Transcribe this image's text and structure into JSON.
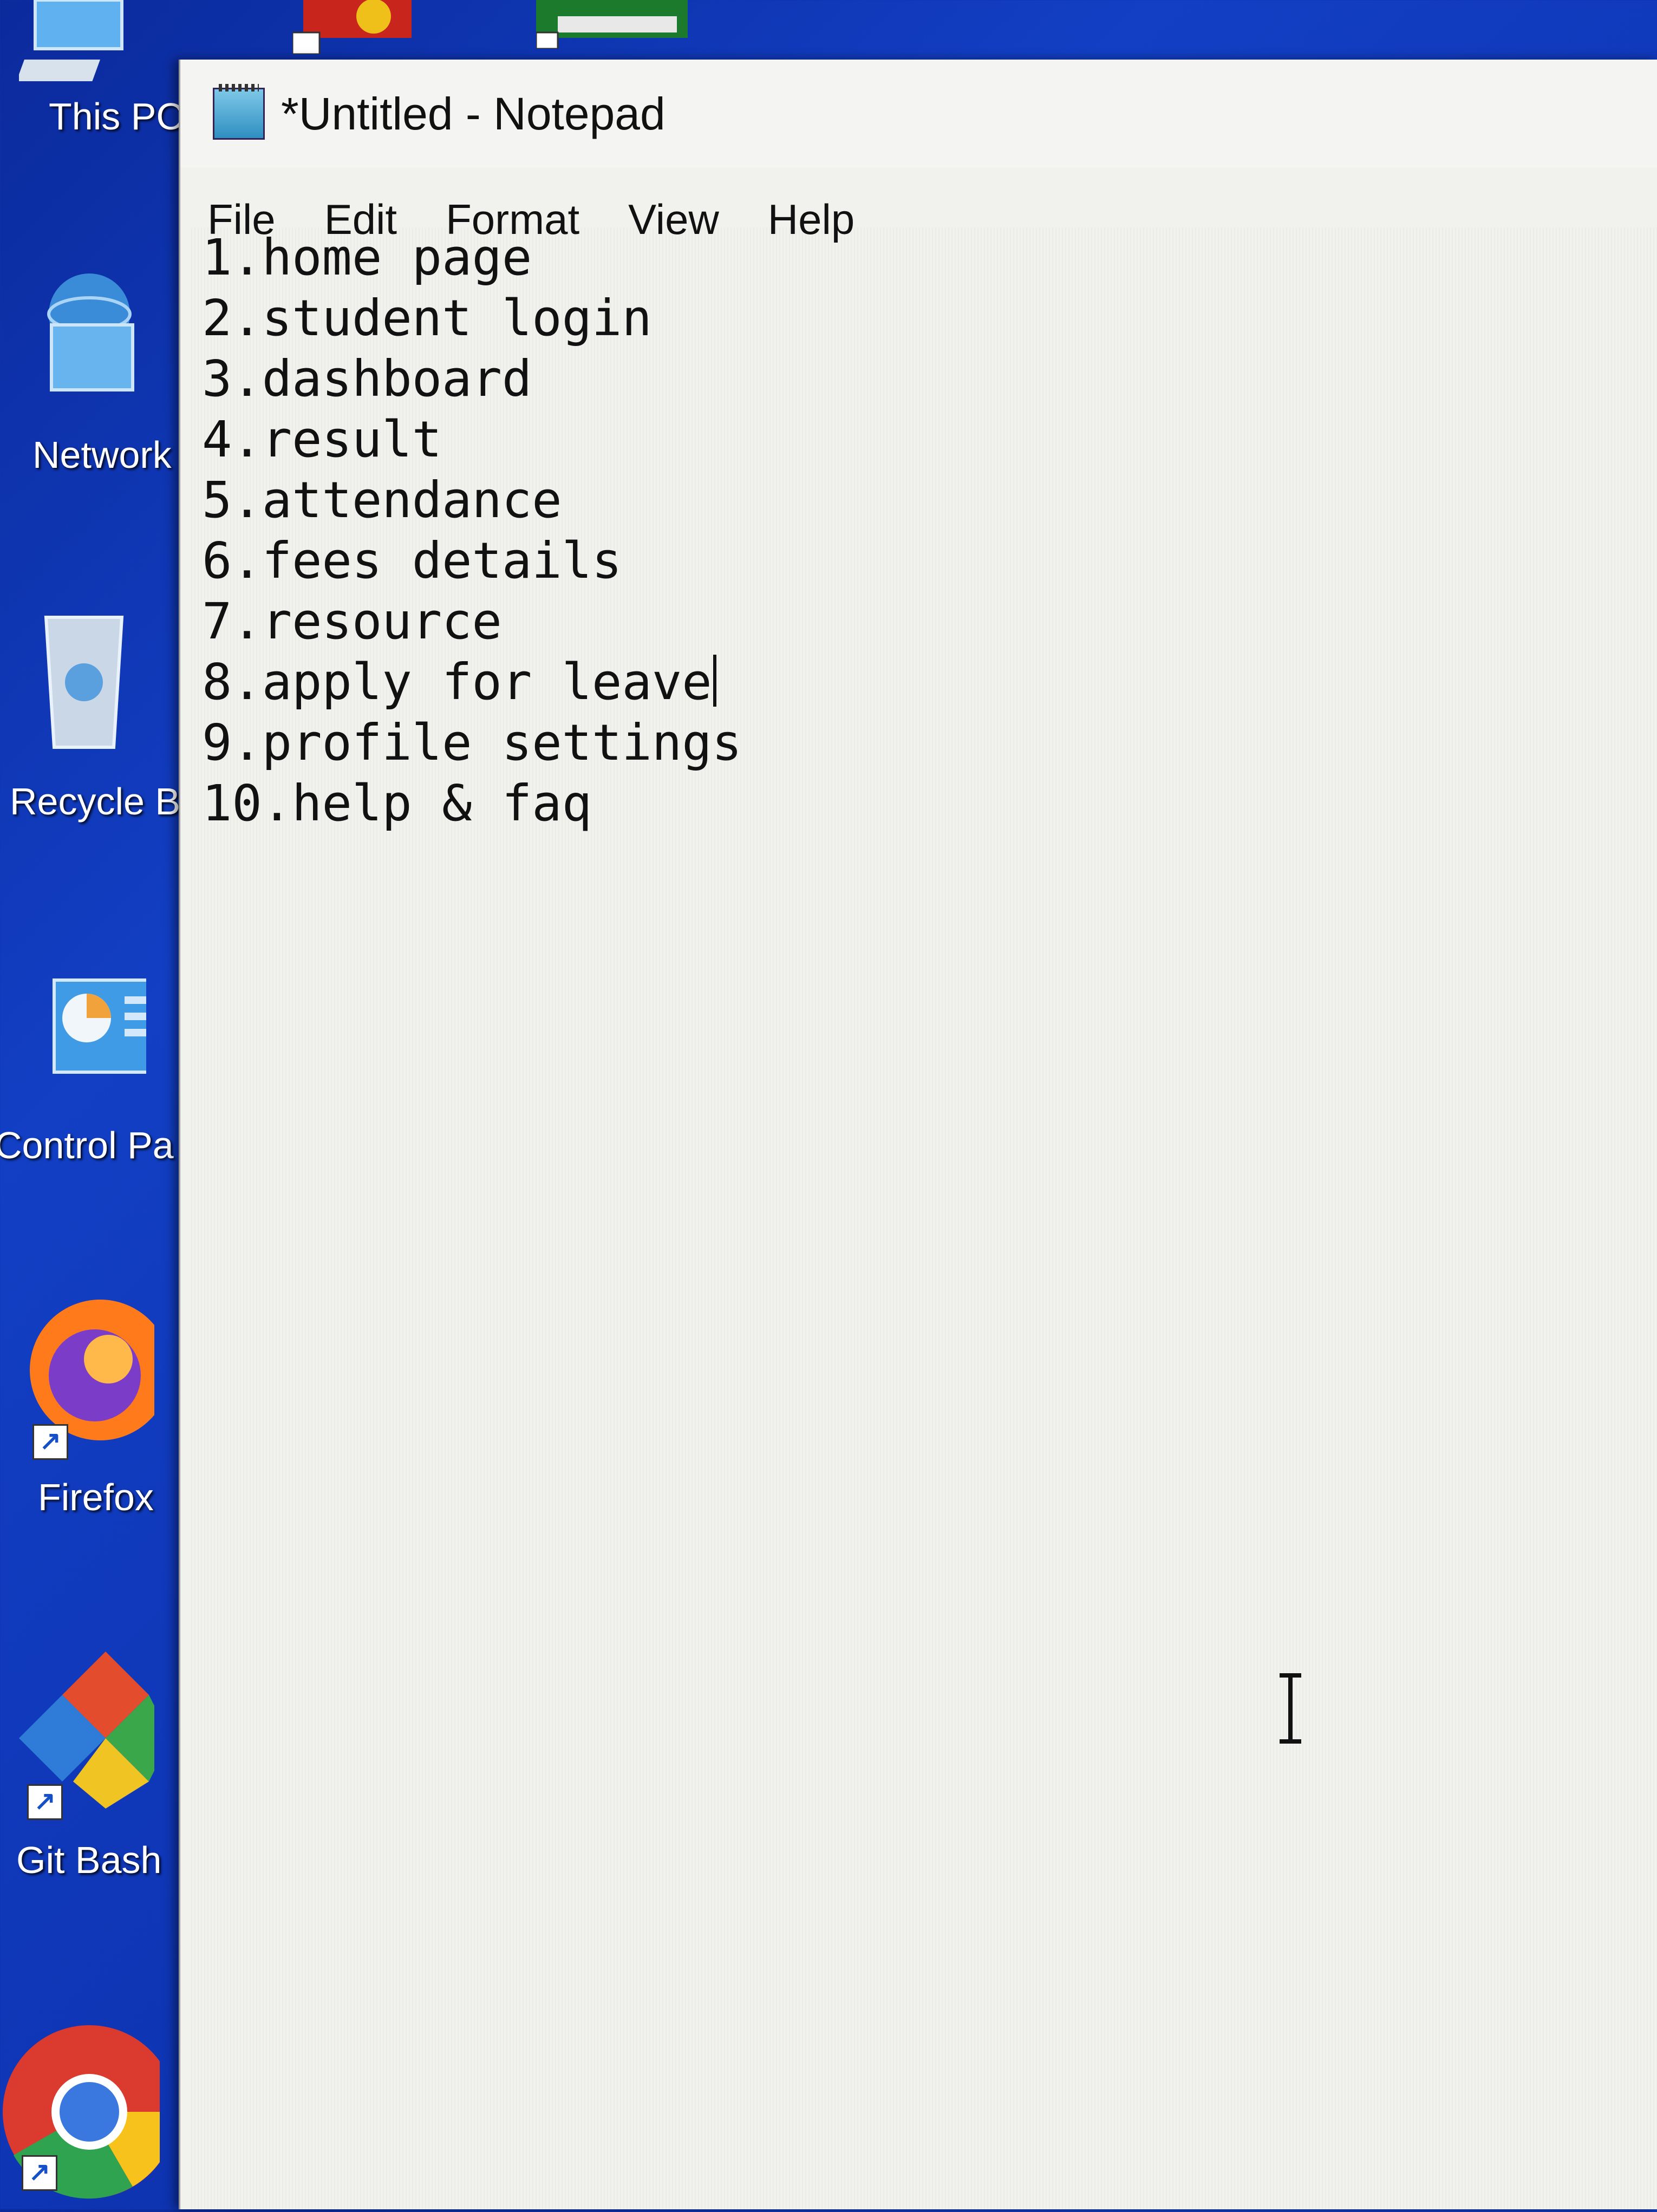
{
  "desktop": {
    "icons": [
      {
        "id": "this-pc",
        "label": "This PC"
      },
      {
        "id": "network",
        "label": "Network"
      },
      {
        "id": "recycle-bin",
        "label": "Recycle B"
      },
      {
        "id": "control-panel",
        "label": "Control Pa"
      },
      {
        "id": "firefox",
        "label": "Firefox"
      },
      {
        "id": "git-bash",
        "label": "Git Bash"
      },
      {
        "id": "chrome",
        "label": ""
      }
    ]
  },
  "window": {
    "title": "*Untitled - Notepad",
    "menu": [
      "File",
      "Edit",
      "Format",
      "View",
      "Help"
    ],
    "lines": [
      "1.home page",
      "2.student login",
      "3.dashboard",
      "4.result",
      "5.attendance",
      "6.fees details",
      "7.resource",
      "8.apply for leave",
      "9.profile settings",
      "10.help & faq"
    ]
  },
  "colors": {
    "desktop_bg": "#123fc4",
    "window_bg": "#f1f1ee",
    "text": "#111111"
  }
}
